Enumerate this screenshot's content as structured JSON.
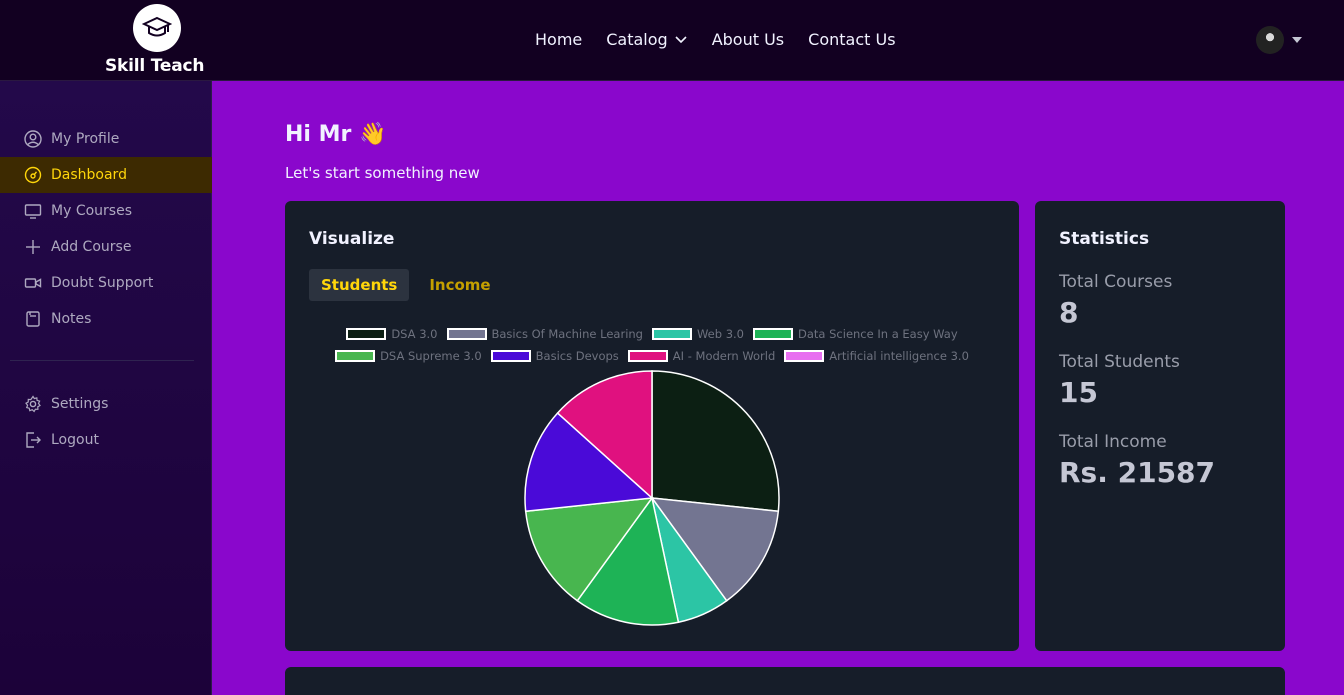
{
  "brand": {
    "name": "Skill Teach"
  },
  "nav": {
    "links": [
      "Home",
      "Catalog",
      "About Us",
      "Contact Us"
    ]
  },
  "sidebar": {
    "items": [
      {
        "label": "My Profile",
        "icon": "user-circle-icon"
      },
      {
        "label": "Dashboard",
        "icon": "gauge-icon",
        "active": true
      },
      {
        "label": "My Courses",
        "icon": "monitor-icon"
      },
      {
        "label": "Add Course",
        "icon": "plus-icon"
      },
      {
        "label": "Doubt Support",
        "icon": "video-icon"
      },
      {
        "label": "Notes",
        "icon": "notebook-icon"
      }
    ],
    "bottom_items": [
      {
        "label": "Settings",
        "icon": "gear-icon"
      },
      {
        "label": "Logout",
        "icon": "logout-icon"
      }
    ]
  },
  "main": {
    "greeting": "Hi Mr 👋",
    "subtitle": "Let's start something new"
  },
  "visualize": {
    "title": "Visualize",
    "tabs": [
      "Students",
      "Income"
    ],
    "active_tab": "Students"
  },
  "statistics": {
    "title": "Statistics",
    "items": [
      {
        "label": "Total Courses",
        "value": "8"
      },
      {
        "label": "Total Students",
        "value": "15"
      },
      {
        "label": "Total Income",
        "value": "Rs. 21587"
      }
    ]
  },
  "colors": {
    "accent": "#ffd60a",
    "page_bg": "#8a07cc",
    "card_bg": "#161d29"
  },
  "chart_data": {
    "type": "pie",
    "categories": [
      "DSA 3.0",
      "Basics Of Machine Learing",
      "Web 3.0",
      "Data Science In a Easy Way",
      "DSA Supreme 3.0",
      "Basics Devops",
      "AI - Modern World",
      "Artificial intelligence 3.0"
    ],
    "values": [
      4,
      2,
      1,
      2,
      2,
      2,
      2,
      0
    ],
    "colors": [
      "#0c1f13",
      "#737591",
      "#2cc5a5",
      "#1eb356",
      "#48b64f",
      "#4a0ad8",
      "#e0117f",
      "#e86ff0"
    ],
    "legend_position": "top"
  }
}
